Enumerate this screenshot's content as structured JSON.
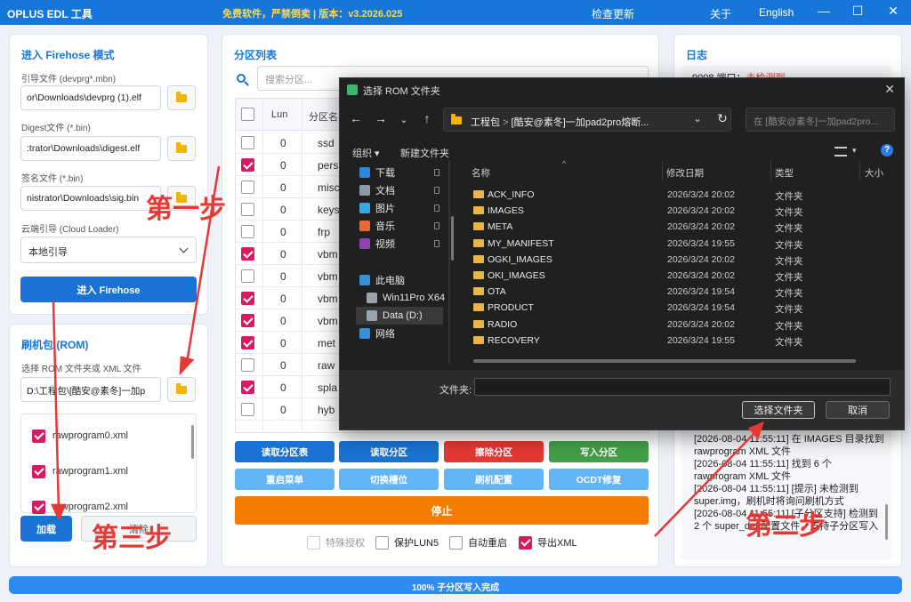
{
  "titlebar": {
    "app_title": "OPLUS EDL 工具",
    "center_text": "免费软件，严禁倒卖 | 版本：v3.2026.025",
    "check_update": "检查更新",
    "about": "关于",
    "language": "English",
    "minimize": "—",
    "maximize": "☐",
    "close": "✕"
  },
  "firehose": {
    "title": "进入 Firehose 模式",
    "loader_label": "引导文件 (devprg*.mbn)",
    "loader_value": "or\\Downloads\\devprg (1).elf",
    "digest_label": "Digest文件 (*.bin)",
    "digest_value": ":trator\\Downloads\\digest.elf",
    "sig_label": "签名文件 (*.bin)",
    "sig_value": "nistrator\\Downloads\\sig.bin",
    "cloud_label": "云端引导 (Cloud Loader)",
    "cloud_value": "本地引导",
    "enter_button": "进入 Firehose"
  },
  "rom": {
    "title": "刷机包 (ROM)",
    "select_label": "选择 ROM 文件夹或 XML 文件",
    "path_value": "D:\\工程包\\[酷安@素冬]一加p",
    "xml_files": [
      {
        "name": "rawprogram0.xml",
        "checked": true
      },
      {
        "name": "rawprogram1.xml",
        "checked": true
      },
      {
        "name": "rawprogram2.xml",
        "checked": true
      }
    ],
    "load_button": "加载",
    "clear_button": "清除"
  },
  "partitions": {
    "title": "分区列表",
    "search_placeholder": "搜索分区...",
    "col_lun": "Lun",
    "col_name": "分区名",
    "rows": [
      {
        "checked": false,
        "lun": "0",
        "name": "ssd"
      },
      {
        "checked": true,
        "lun": "0",
        "name": "pers"
      },
      {
        "checked": false,
        "lun": "0",
        "name": "misc"
      },
      {
        "checked": false,
        "lun": "0",
        "name": "keys"
      },
      {
        "checked": false,
        "lun": "0",
        "name": "frp"
      },
      {
        "checked": true,
        "lun": "0",
        "name": "vbm"
      },
      {
        "checked": false,
        "lun": "0",
        "name": "vbm"
      },
      {
        "checked": true,
        "lun": "0",
        "name": "vbm"
      },
      {
        "checked": true,
        "lun": "0",
        "name": "vbm"
      },
      {
        "checked": true,
        "lun": "0",
        "name": "met"
      },
      {
        "checked": false,
        "lun": "0",
        "name": "raw"
      },
      {
        "checked": true,
        "lun": "0",
        "name": "spla"
      },
      {
        "checked": false,
        "lun": "0",
        "name": "hyb"
      }
    ],
    "buttons_row1": [
      {
        "label": "读取分区表",
        "color": "#1a73d4"
      },
      {
        "label": "读取分区",
        "color": "#1a73d4"
      },
      {
        "label": "擦除分区",
        "color": "#e53935"
      },
      {
        "label": "写入分区",
        "color": "#43a047"
      }
    ],
    "buttons_row2": [
      {
        "label": "重启菜单",
        "color": "#64b5f6"
      },
      {
        "label": "切换槽位",
        "color": "#64b5f6"
      },
      {
        "label": "刷机配置",
        "color": "#64b5f6"
      },
      {
        "label": "OCDT修复",
        "color": "#64b5f6"
      }
    ],
    "stop_button": "停止",
    "options": [
      {
        "label": "特殊授权",
        "checked": false,
        "disabled": true
      },
      {
        "label": "保护LUN5",
        "checked": false,
        "disabled": false
      },
      {
        "label": "自动重启",
        "checked": false,
        "disabled": false
      },
      {
        "label": "导出XML",
        "checked": true,
        "disabled": false
      }
    ]
  },
  "log": {
    "title": "日志",
    "top_line_prefix": "9008 端口：",
    "top_line_status": "未检测到",
    "lines": [
      "[2026-08-04 11:55:11] 在 IMAGES 目录找到",
      "rawprogram XML 文件",
      "[2026-08-04 11:55:11] 找到 6 个",
      "rawprogram XML 文件",
      "[2026-08-04 11:55:11] [提示] 未检测到",
      "super.img，刷机时将询问刷机方式",
      "[2026-08-04 11:55:11] [子分区支持] 检测到",
      "2 个 super_def 配置文件，支持子分区写入"
    ]
  },
  "progress": {
    "value": 100,
    "text": "100% 子分区写入完成"
  },
  "dialog": {
    "title": "选择 ROM 文件夹",
    "breadcrumb_1": "工程包",
    "breadcrumb_2": "[酷安@素冬]一加pad2pro熔断...",
    "search_placeholder": "在 [酷安@素冬]一加pad2pro...",
    "organize": "组织 ▾",
    "new_folder": "新建文件夹",
    "nav_items": [
      {
        "label": "下载",
        "color": "#2e86de"
      },
      {
        "label": "文档",
        "color": "#8e9aa8"
      },
      {
        "label": "图片",
        "color": "#3ba7e0"
      },
      {
        "label": "音乐",
        "color": "#e56a3a"
      },
      {
        "label": "视频",
        "color": "#8e44ad"
      },
      {
        "label": "此电脑",
        "color": "#3b8fd8"
      },
      {
        "label": "Win11Pro X64",
        "color": "#9aa4ae"
      },
      {
        "label": "Data (D:)",
        "color": "#9aa4ae"
      },
      {
        "label": "网络",
        "color": "#3b8fd8"
      }
    ],
    "col_name": "名称",
    "col_date": "修改日期",
    "col_type": "类型",
    "col_size": "大小",
    "files": [
      {
        "name": "ACK_INFO",
        "date": "2026/3/24 20:02",
        "type": "文件夹"
      },
      {
        "name": "IMAGES",
        "date": "2026/3/24 20:02",
        "type": "文件夹"
      },
      {
        "name": "META",
        "date": "2026/3/24 20:02",
        "type": "文件夹"
      },
      {
        "name": "MY_MANIFEST",
        "date": "2026/3/24 19:55",
        "type": "文件夹"
      },
      {
        "name": "OGKI_IMAGES",
        "date": "2026/3/24 20:02",
        "type": "文件夹"
      },
      {
        "name": "OKI_IMAGES",
        "date": "2026/3/24 20:02",
        "type": "文件夹"
      },
      {
        "name": "OTA",
        "date": "2026/3/24 19:54",
        "type": "文件夹"
      },
      {
        "name": "PRODUCT",
        "date": "2026/3/24 19:54",
        "type": "文件夹"
      },
      {
        "name": "RADIO",
        "date": "2026/3/24 20:02",
        "type": "文件夹"
      },
      {
        "name": "RECOVERY",
        "date": "2026/3/24 19:55",
        "type": "文件夹"
      }
    ],
    "folder_label": "文件夹:",
    "select_button": "选择文件夹",
    "cancel_button": "取消"
  },
  "annotations": {
    "step1": "第一步",
    "step2": "第二步",
    "step3": "第三步",
    "color": "#e53935"
  }
}
